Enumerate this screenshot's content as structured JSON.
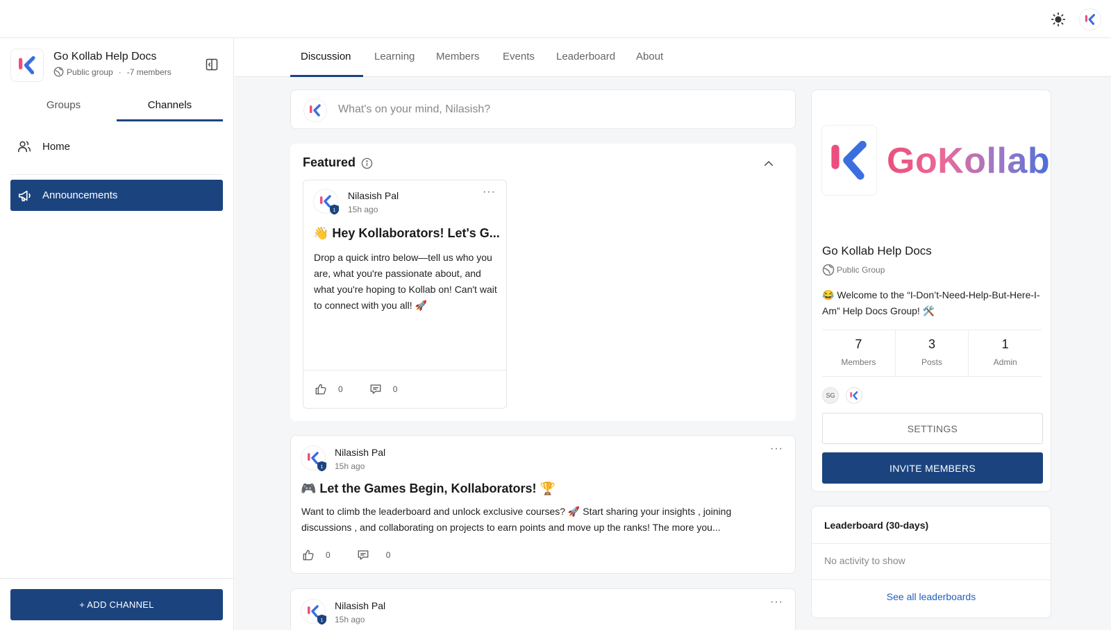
{
  "sidebar": {
    "group_name": "Go Kollab Help Docs",
    "group_type": "Public group",
    "group_members": "-7 members",
    "tabs": [
      {
        "label": "Groups"
      },
      {
        "label": "Channels"
      }
    ],
    "nav": [
      {
        "label": "Home",
        "icon": "users-icon"
      },
      {
        "label": "Announcements",
        "icon": "megaphone-icon"
      }
    ],
    "add_channel_label": "+ ADD CHANNEL"
  },
  "main_tabs": [
    {
      "label": "Discussion"
    },
    {
      "label": "Learning"
    },
    {
      "label": "Members"
    },
    {
      "label": "Events"
    },
    {
      "label": "Leaderboard"
    },
    {
      "label": "About"
    }
  ],
  "composer": {
    "placeholder": "What's on your mind, Nilasish?"
  },
  "featured": {
    "title": "Featured",
    "post": {
      "author": "Nilasish Pal",
      "time": "15h ago",
      "title": "👋 Hey Kollaborators! Let's G...",
      "body": "Drop a quick intro below—tell us who you are, what you're passionate about, and what you're hoping to Kollab on! Can't wait to connect with you all! 🚀",
      "likes": "0",
      "comments": "0"
    }
  },
  "posts": [
    {
      "author": "Nilasish Pal",
      "time": "15h ago",
      "title": "🎮 Let the Games Begin, Kollaborators! 🏆",
      "body": "Want to climb the leaderboard and unlock exclusive courses? 🚀 Start sharing your insights , joining discussions , and collaborating on projects to earn points and move up the ranks! The more you...",
      "likes": "0",
      "comments": "0"
    },
    {
      "author": "Nilasish Pal",
      "time": "15h ago"
    }
  ],
  "about": {
    "brand_text": "GoKollab",
    "name": "Go Kollab Help Docs",
    "type": "Public Group",
    "description": "😂 Welcome to the “I-Don’t-Need-Help-But-Here-I-Am” Help Docs Group! 🛠️",
    "stats": [
      {
        "value": "7",
        "label": "Members"
      },
      {
        "value": "3",
        "label": "Posts"
      },
      {
        "value": "1",
        "label": "Admin"
      }
    ],
    "member_initials": "SG",
    "settings_label": "SETTINGS",
    "invite_label": "INVITE MEMBERS"
  },
  "leaderboard": {
    "title": "Leaderboard (30-days)",
    "empty_text": "No activity to show",
    "link_text": "See all leaderboards"
  },
  "colors": {
    "primary": "#1b447f",
    "logo_pink": "#ec4e7d",
    "logo_blue": "#3b6fe0",
    "link": "#1f5fbf"
  }
}
